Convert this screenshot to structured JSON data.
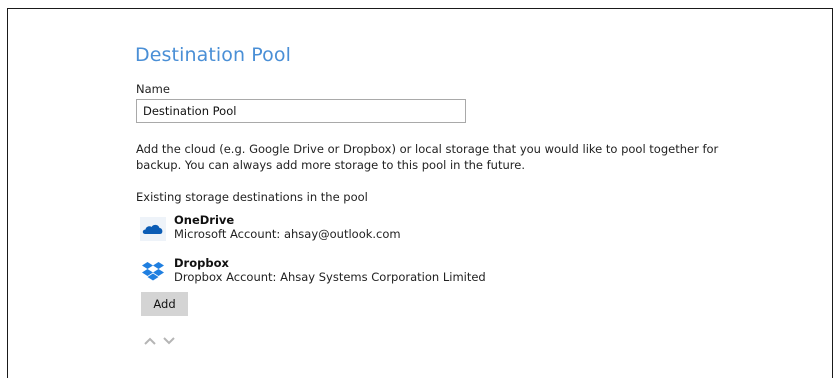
{
  "page": {
    "title": "Destination Pool"
  },
  "name_field": {
    "label": "Name",
    "value": "Destination Pool"
  },
  "description": "Add the cloud (e.g. Google Drive or Dropbox) or local storage that you would like to pool together for backup. You can always add more storage to this pool in the future.",
  "existing_label": "Existing storage destinations in the pool",
  "destinations": [
    {
      "name": "OneDrive",
      "account": "Microsoft Account: ahsay@outlook.com",
      "icon": "onedrive-icon"
    },
    {
      "name": "Dropbox",
      "account": "Dropbox Account: Ahsay Systems Corporation Limited",
      "icon": "dropbox-icon"
    }
  ],
  "add_button": {
    "label": "Add"
  },
  "colors": {
    "title": "#4a8fd6",
    "onedrive": "#0b5cb5",
    "dropbox": "#1f7fe0",
    "button_bg": "#d4d4d4",
    "arrow": "#b5b5b5"
  }
}
